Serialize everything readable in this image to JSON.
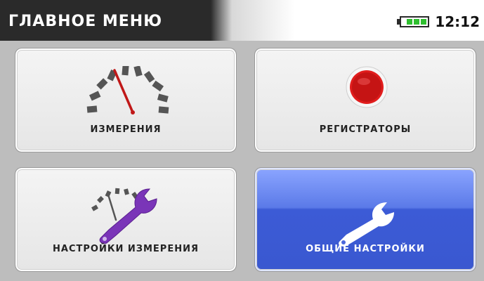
{
  "header": {
    "title": "ГЛАВНОЕ МЕНЮ",
    "time": "12:12",
    "battery_level": 0.7
  },
  "menu": {
    "tiles": [
      {
        "label": "ИЗМЕРЕНИЯ",
        "icon": "gauge-icon"
      },
      {
        "label": "РЕГИСТРАТОРЫ",
        "icon": "record-icon"
      },
      {
        "label": "НАСТРОЙКИ ИЗМЕРЕНИЯ",
        "icon": "measurement-settings-icon"
      },
      {
        "label": "ОБЩИЕ НАСТРОЙКИ",
        "icon": "wrench-icon",
        "selected": true
      }
    ]
  },
  "colors": {
    "header_bg": "#2a2a2a",
    "battery_green": "#2fbf2f",
    "record_red": "#d41e1e",
    "selected_tile": "#4a67dc",
    "wrench_purple": "#7a35b8"
  }
}
